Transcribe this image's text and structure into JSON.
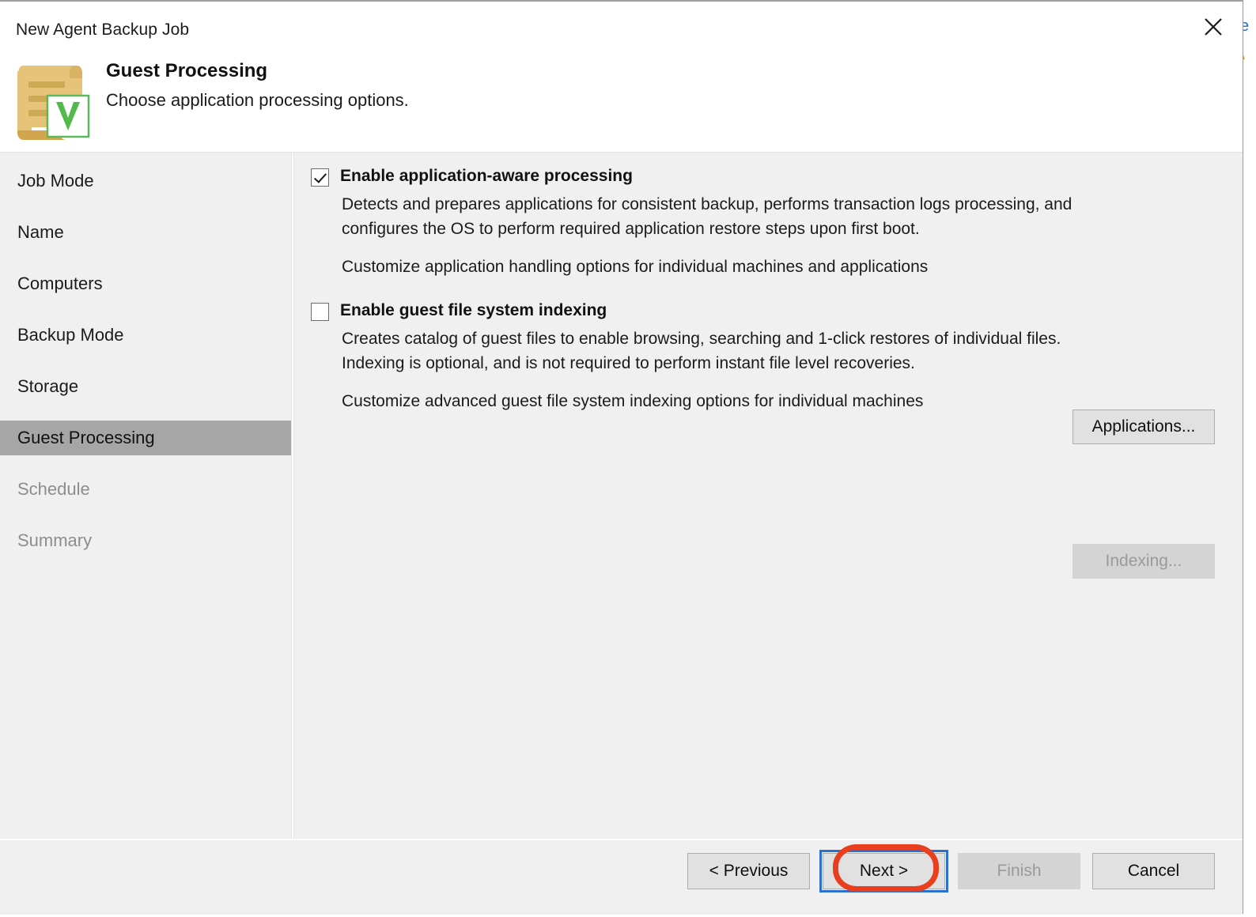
{
  "window": {
    "title": "New Agent Backup Job",
    "close_icon": "close-icon"
  },
  "header": {
    "icon": "guest-processing-document-icon",
    "title": "Guest Processing",
    "subtitle": "Choose application processing options."
  },
  "sidebar": {
    "items": [
      {
        "label": "Job Mode",
        "state": "enabled"
      },
      {
        "label": "Name",
        "state": "enabled"
      },
      {
        "label": "Computers",
        "state": "enabled"
      },
      {
        "label": "Backup Mode",
        "state": "enabled"
      },
      {
        "label": "Storage",
        "state": "enabled"
      },
      {
        "label": "Guest Processing",
        "state": "selected"
      },
      {
        "label": "Schedule",
        "state": "disabled"
      },
      {
        "label": "Summary",
        "state": "disabled"
      }
    ]
  },
  "main": {
    "app_aware": {
      "checkbox_label": "Enable application-aware processing",
      "checked": true,
      "description_line1": "Detects and prepares applications for consistent backup, performs transaction logs processing, and",
      "description_line2": "configures the OS to perform required application restore steps upon first boot.",
      "customize_text": "Customize application handling options for individual machines and applications",
      "button_label": "Applications...",
      "button_enabled": true
    },
    "indexing": {
      "checkbox_label": "Enable guest file system indexing",
      "checked": false,
      "description_line1": "Creates catalog of guest files to enable browsing, searching and 1-click restores of individual files.",
      "description_line2": "Indexing is optional, and is not required to perform instant file level recoveries.",
      "customize_text": "Customize advanced guest file system indexing options for individual machines",
      "button_label": "Indexing...",
      "button_enabled": false
    }
  },
  "footer": {
    "previous_label": "< Previous",
    "next_label": "Next >",
    "finish_label": "Finish",
    "cancel_label": "Cancel",
    "finish_enabled": false,
    "focused_button": "Next >"
  },
  "annotation": {
    "shape": "ellipse",
    "target": "Next >",
    "color": "#e8401e"
  },
  "colors": {
    "dialog_bg": "#ffffff",
    "panel_bg": "#f0f0f0",
    "selection_bg": "#a6a6a6",
    "button_face": "#e1e1e1",
    "button_disabled": "#d4d4d4",
    "focus_blue": "#2a6fd4",
    "annotation_red": "#e8401e",
    "icon_gold": "#e3c275",
    "icon_green": "#58b947"
  },
  "background_sliver": {
    "glyph1": "e",
    "glyph2": "\\"
  }
}
